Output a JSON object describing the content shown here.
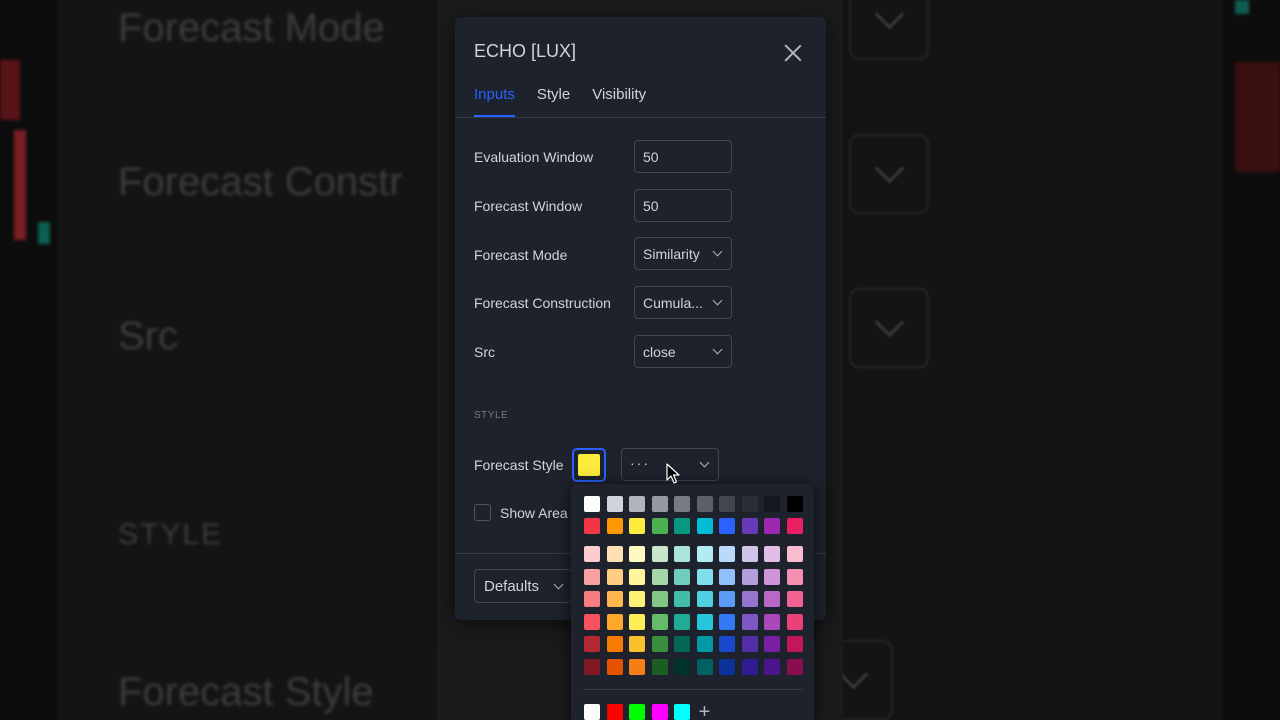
{
  "background": {
    "labels": [
      "Forecast Mode",
      "Forecast Constr",
      "Src",
      "STYLE",
      "Forecast Style"
    ]
  },
  "dialog": {
    "title": "ECHO [LUX]",
    "tabs": [
      {
        "label": "Inputs",
        "active": true
      },
      {
        "label": "Style",
        "active": false
      },
      {
        "label": "Visibility",
        "active": false
      }
    ],
    "inputs": [
      {
        "label": "Evaluation Window",
        "value": "50",
        "kind": "number"
      },
      {
        "label": "Forecast Window",
        "value": "50",
        "kind": "number"
      },
      {
        "label": "Forecast Mode",
        "value": "Similarity",
        "kind": "select"
      },
      {
        "label": "Forecast Construction",
        "value": "Cumula...",
        "kind": "select"
      },
      {
        "label": "Src",
        "value": "close",
        "kind": "select"
      }
    ],
    "style_section": {
      "heading": "STYLE",
      "forecast_style_label": "Forecast Style",
      "forecast_color": "#fdeb3b",
      "line_style_value": "···",
      "show_area_label": "Show Area",
      "show_area_checked": false
    },
    "footer": {
      "defaults_label": "Defaults"
    }
  },
  "palette": {
    "selected_color": "#fdeb3b",
    "grays": [
      "#ffffff",
      "#d1d4dc",
      "#b2b5be",
      "#9598a1",
      "#787b86",
      "#5d606b",
      "#434651",
      "#2a2e39",
      "#131722",
      "#000000"
    ],
    "primaries": [
      "#f23645",
      "#ff9800",
      "#ffeb3b",
      "#4caf50",
      "#089981",
      "#00bcd4",
      "#2962ff",
      "#673ab7",
      "#9c27b0",
      "#e91e63"
    ],
    "shades": [
      [
        "#fccbcd",
        "#ffe0b2",
        "#fff9c4",
        "#c8e6c9",
        "#ace5dc",
        "#b2ebf2",
        "#bbd9fb",
        "#d1c4e9",
        "#e1bee7",
        "#f8bbd0"
      ],
      [
        "#faa1a4",
        "#ffcc80",
        "#fff59d",
        "#a5d6a7",
        "#70ccbd",
        "#80deea",
        "#90bff9",
        "#b39ddb",
        "#ce93d8",
        "#f48fb1"
      ],
      [
        "#f77c80",
        "#ffb74d",
        "#fff176",
        "#81c784",
        "#42bda8",
        "#4dd0e1",
        "#5b9cf6",
        "#9575cd",
        "#ba68c8",
        "#f06292"
      ],
      [
        "#f7525f",
        "#ffa726",
        "#ffee58",
        "#66bb6a",
        "#22ab94",
        "#26c6da",
        "#3179f5",
        "#7e57c2",
        "#ab47bc",
        "#ec407a"
      ],
      [
        "#b22833",
        "#f57c00",
        "#fbc02d",
        "#388e3c",
        "#056656",
        "#0097a7",
        "#1848cc",
        "#512da8",
        "#7b1fa2",
        "#c2185b"
      ],
      [
        "#801922",
        "#e65100",
        "#f57f17",
        "#1b5e20",
        "#00332a",
        "#006064",
        "#0c3299",
        "#311b92",
        "#4a148c",
        "#880e4f"
      ]
    ],
    "custom": [
      "#ffffff",
      "#ff0000",
      "#00ff00",
      "#ff00ff",
      "#00ffff"
    ]
  }
}
